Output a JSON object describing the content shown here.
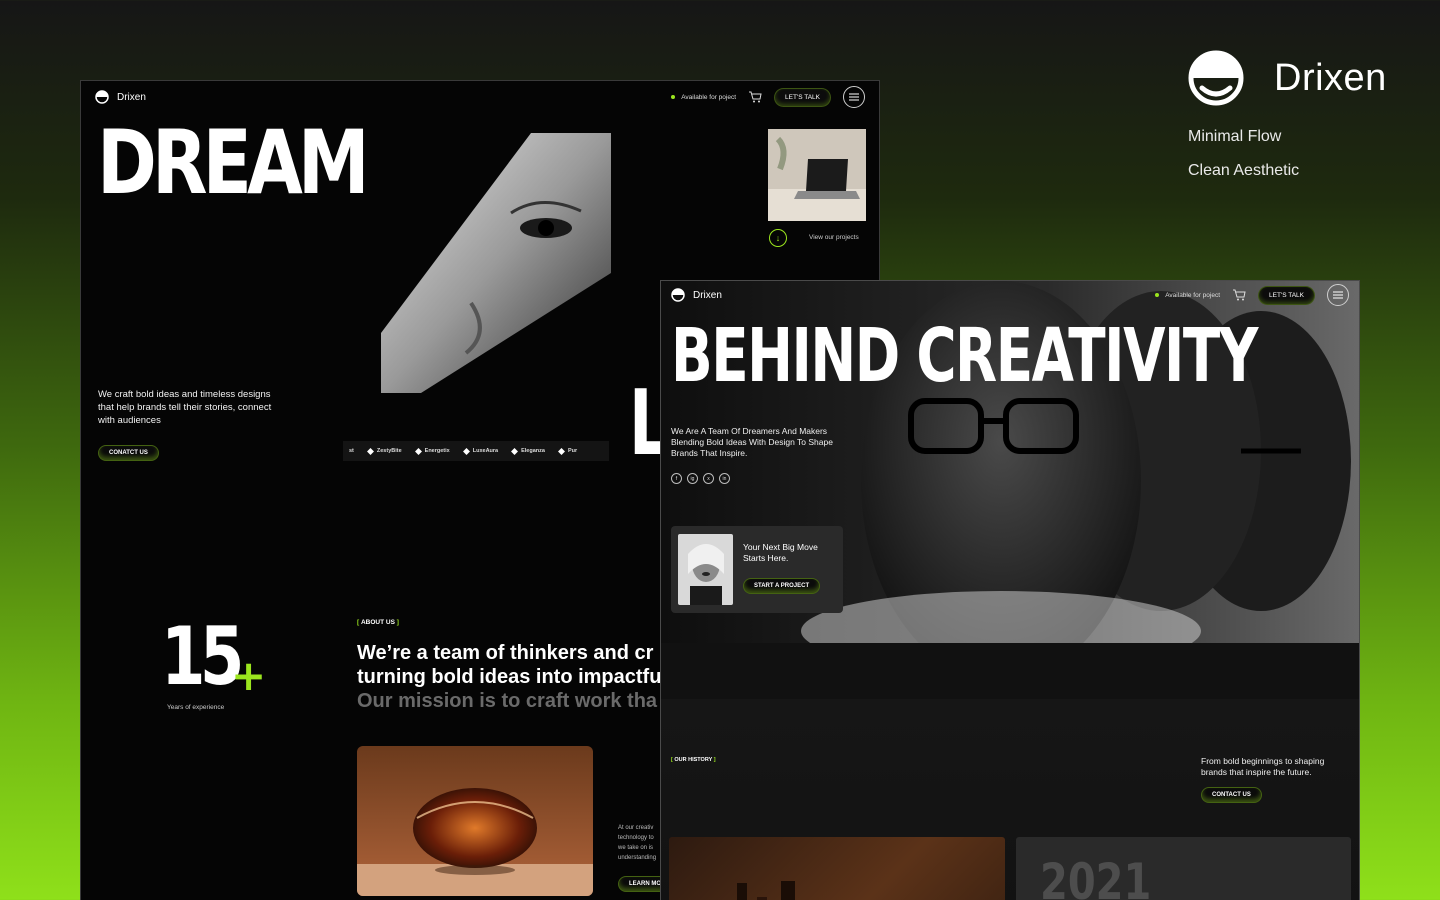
{
  "brand": {
    "name": "Drixen",
    "taglines": [
      "Minimal Flow",
      "Clean Aesthetic"
    ],
    "accent": "#9be51e"
  },
  "mock1": {
    "nav": {
      "logo": "Drixen",
      "availability": "Available for poject",
      "cta": "LET'S TALK",
      "icons": [
        "cart-icon",
        "menu-icon"
      ]
    },
    "hero": {
      "headline": "DREAM",
      "second_word_fragment": "L",
      "copy": "We craft bold ideas and timeless designs that help brands tell their stories, connect with audiences",
      "contact_button": "CONATCT US",
      "view_projects": "View our projects"
    },
    "partners": [
      {
        "partial": "st"
      },
      {
        "name": "ZestyBite"
      },
      {
        "name": "Energetix"
      },
      {
        "name": "LuxeAura"
      },
      {
        "name": "Eleganza"
      },
      {
        "name": "Pur"
      }
    ],
    "stats": {
      "value": "15",
      "suffix": "+",
      "label": "Years of experience"
    },
    "about": {
      "tag": "ABOUT US",
      "line1": "We’re a team of thinkers and cr",
      "line2": "turning bold ideas into impactfu",
      "line3": "Our mission is to craft work tha"
    },
    "side_text": [
      "At our creativ",
      "technology to",
      "we take on is",
      "understanding"
    ],
    "learn_button": "LEARN MO"
  },
  "mock2": {
    "nav": {
      "logo": "Drixen",
      "availability": "Available for poject",
      "cta": "LET'S TALK"
    },
    "hero": {
      "headline": "BEHIND CREATIVITY",
      "copy": "We Are A Team Of Dreamers And Makers Blending Bold Ideas With Design To Shape Brands That Inspire.",
      "socials": [
        "f",
        "ig",
        "x",
        "in"
      ]
    },
    "next_card": {
      "title": "Your Next Big Move Starts Here.",
      "button": "START A PROJECT"
    },
    "history": {
      "tag": "OUR HISTORY",
      "copy": "From bold beginnings to shaping brands that inspire the future.",
      "button": "CONTACT US",
      "year": "2021"
    }
  }
}
